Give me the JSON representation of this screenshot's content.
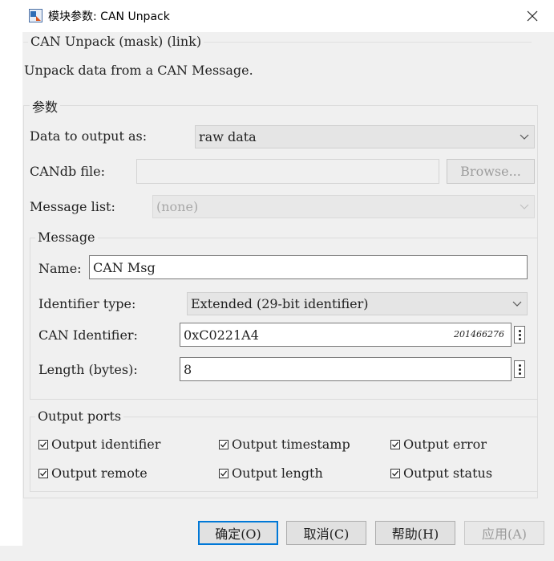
{
  "window": {
    "title": "模块参数: CAN Unpack",
    "close_glyph": "✕",
    "icon_name": "simulink-block-icon"
  },
  "description_group": {
    "legend": "CAN Unpack (mask) (link)",
    "text": "Unpack data from a CAN Message."
  },
  "params": {
    "legend": "参数",
    "data_output_label": "Data to output as:",
    "data_output_value": "raw data",
    "candb_label": "CANdb file:",
    "candb_value": "",
    "browse_label": "Browse...",
    "message_list_label": "Message list:",
    "message_list_value": "(none)"
  },
  "message": {
    "legend": "Message",
    "name_label": "Name:",
    "name_value": "CAN Msg",
    "id_type_label": "Identifier type:",
    "id_type_value": "Extended (29-bit identifier)",
    "can_id_label": "CAN Identifier:",
    "can_id_value": "0xC0221A4",
    "can_id_decimal": "201466276",
    "length_label": "Length (bytes):",
    "length_value": "8"
  },
  "output_ports": {
    "legend": "Output ports",
    "items": [
      {
        "label": "Output identifier",
        "checked": true
      },
      {
        "label": "Output timestamp",
        "checked": true
      },
      {
        "label": "Output error",
        "checked": true
      },
      {
        "label": "Output remote",
        "checked": true
      },
      {
        "label": "Output length",
        "checked": true
      },
      {
        "label": "Output status",
        "checked": true
      }
    ]
  },
  "buttons": {
    "ok": "确定(O)",
    "cancel": "取消(C)",
    "help": "帮助(H)",
    "apply": "应用(A)"
  },
  "colors": {
    "default_button_border": "#0078d7"
  }
}
